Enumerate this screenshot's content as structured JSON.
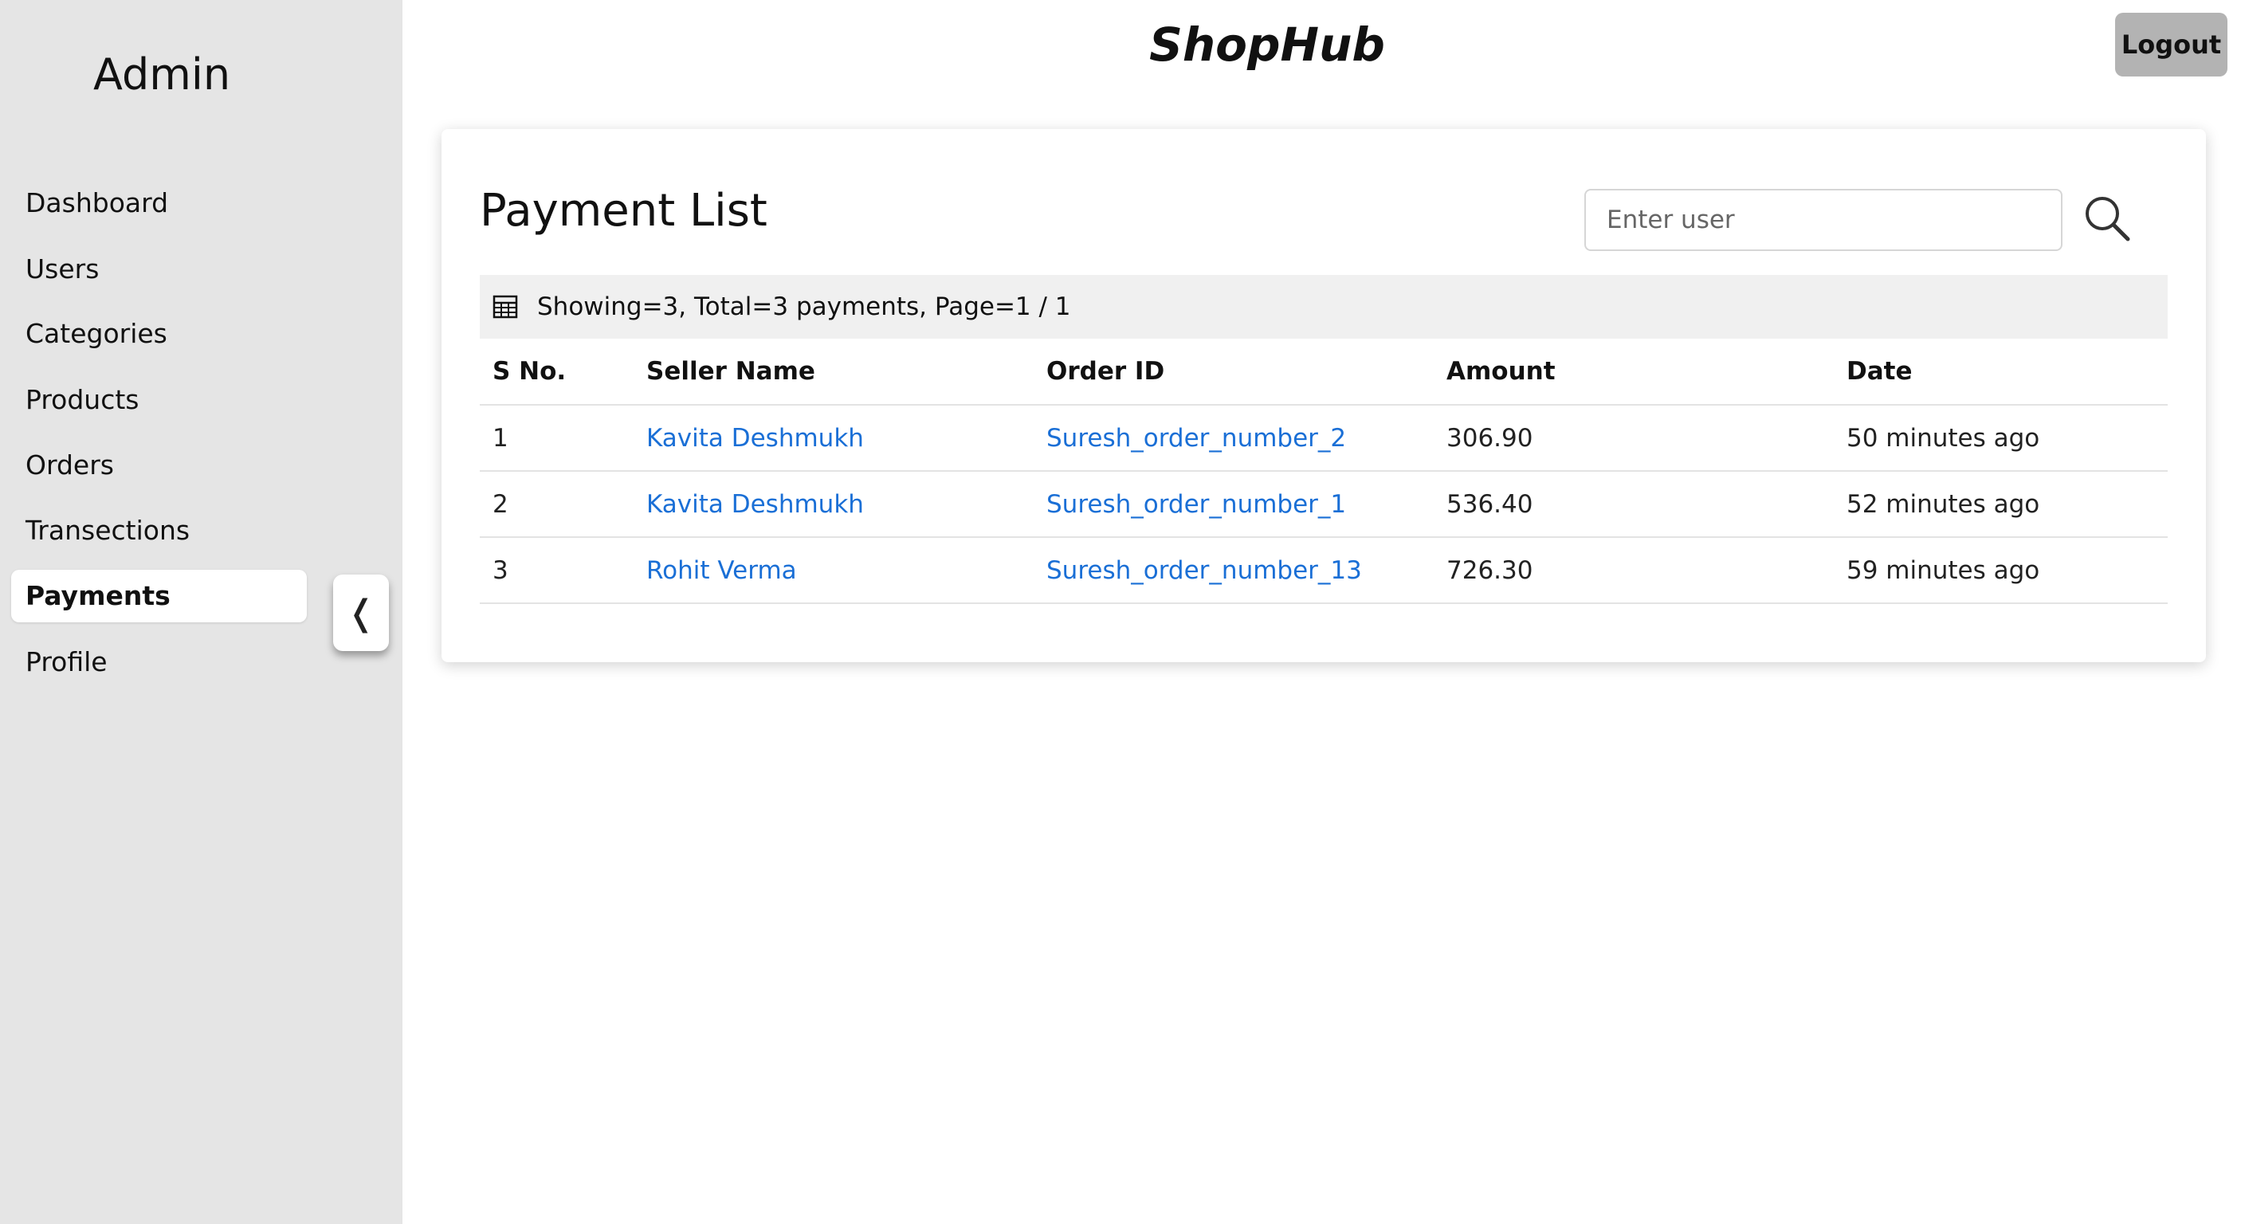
{
  "app": {
    "brand": "ShopHub",
    "logout_label": "Logout"
  },
  "sidebar": {
    "title": "Admin",
    "items": [
      {
        "label": "Dashboard"
      },
      {
        "label": "Users"
      },
      {
        "label": "Categories"
      },
      {
        "label": "Products"
      },
      {
        "label": "Orders"
      },
      {
        "label": "Transections"
      },
      {
        "label": "Payments",
        "active": true
      },
      {
        "label": "Profile"
      }
    ],
    "collapse_glyph": "❬"
  },
  "payments": {
    "title": "Payment List",
    "search_placeholder": "Enter user",
    "summary": "Showing=3, Total=3 payments, Page=1 / 1",
    "columns": [
      "S No.",
      "Seller Name",
      "Order ID",
      "Amount",
      "Date"
    ],
    "rows": [
      {
        "sno": "1",
        "seller": "Kavita Deshmukh",
        "order_id": "Suresh_order_number_2",
        "amount": "306.90",
        "date": "50 minutes ago"
      },
      {
        "sno": "2",
        "seller": "Kavita Deshmukh",
        "order_id": "Suresh_order_number_1",
        "amount": "536.40",
        "date": "52 minutes ago"
      },
      {
        "sno": "3",
        "seller": "Rohit Verma",
        "order_id": "Suresh_order_number_13",
        "amount": "726.30",
        "date": "59 minutes ago"
      }
    ]
  },
  "colors": {
    "sidebar_bg": "#e5e5e5",
    "link": "#1a6fd6",
    "logout_bg": "#b3b3b3",
    "info_bar_bg": "#f0f0f0"
  }
}
